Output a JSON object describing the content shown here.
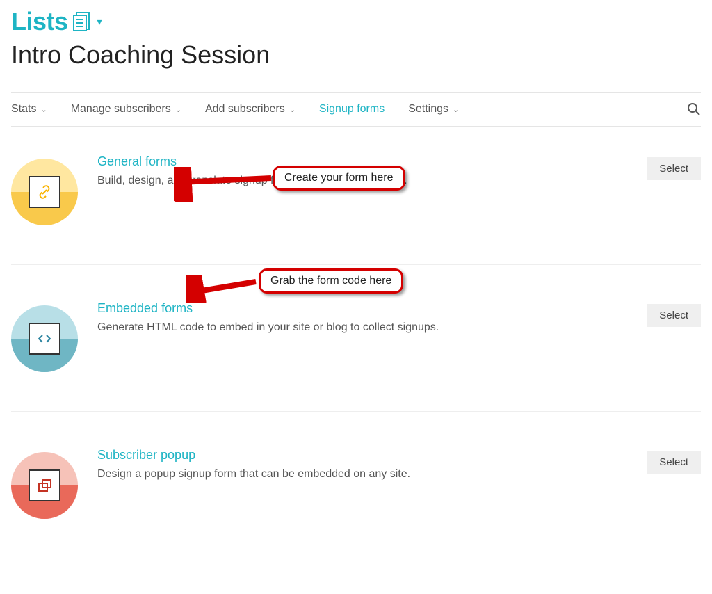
{
  "breadcrumb": {
    "label": "Lists"
  },
  "page_title": "Intro Coaching Session",
  "tabs": {
    "stats": "Stats",
    "manage": "Manage subscribers",
    "add": "Add subscribers",
    "signup": "Signup forms",
    "settings": "Settings"
  },
  "options": {
    "general": {
      "title": "General forms",
      "desc": "Build, design, and translate signup forms and response emails.",
      "select": "Select"
    },
    "embedded": {
      "title": "Embedded forms",
      "desc": "Generate HTML code to embed in your site or blog to collect signups.",
      "select": "Select"
    },
    "popup": {
      "title": "Subscriber popup",
      "desc": "Design a popup signup form that can be embedded on any site.",
      "select": "Select"
    }
  },
  "annotations": {
    "a1": "Create your form here",
    "a2": "Grab the form code here"
  }
}
